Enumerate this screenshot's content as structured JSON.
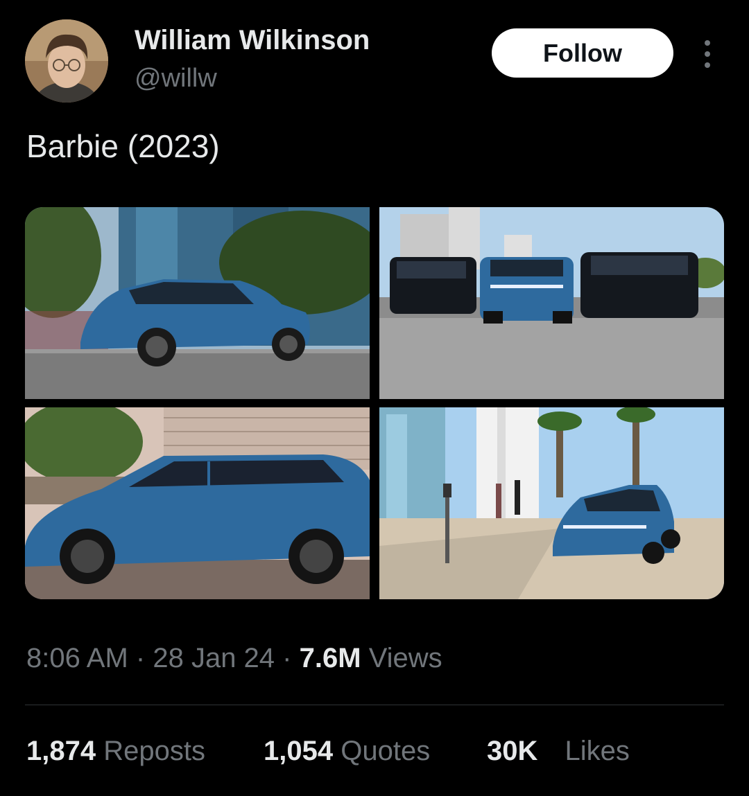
{
  "author": {
    "name": "William Wilkinson",
    "handle": "@willw"
  },
  "follow_label": "Follow",
  "post": {
    "text": "Barbie (2023)",
    "images": [
      {
        "icon": "photo-blue-suv-driving"
      },
      {
        "icon": "photo-three-suvs-road"
      },
      {
        "icon": "photo-blue-suv-side"
      },
      {
        "icon": "photo-blue-suv-parked"
      }
    ]
  },
  "meta": {
    "time": "8:06 AM",
    "separator": "·",
    "date": "28 Jan 24",
    "views_count": "7.6M",
    "views_label": "Views"
  },
  "stats": {
    "reposts_count": "1,874",
    "reposts_label": "Reposts",
    "quotes_count": "1,054",
    "quotes_label": "Quotes",
    "likes_count": "30K",
    "likes_label": "Likes"
  },
  "colors": {
    "background": "#000000",
    "text_primary": "#e7e9ea",
    "text_secondary": "#71767b",
    "follow_bg": "#ffffff",
    "car_blue": "#2e6a9e"
  }
}
